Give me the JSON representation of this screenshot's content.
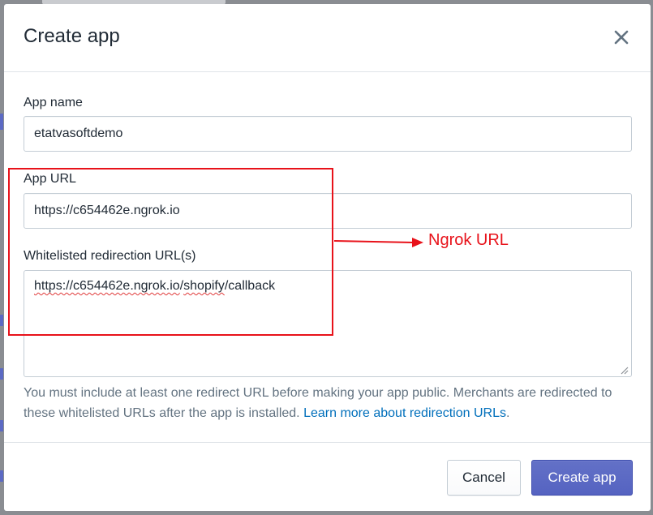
{
  "modal": {
    "title": "Create app",
    "close_icon": "close-icon"
  },
  "fields": {
    "app_name": {
      "label": "App name",
      "value": "etatvasoftdemo"
    },
    "app_url": {
      "label": "App URL",
      "value": "https://c654462e.ngrok.io"
    },
    "redirect_urls": {
      "label": "Whitelisted redirection URL(s)",
      "value_parts": [
        "https://c654462e.ngrok.io",
        "/",
        "shopify",
        "/callback"
      ]
    }
  },
  "help": {
    "text": "You must include at least one redirect URL before making your app public. Merchants are redirected to these whitelisted URLs after the app is installed. ",
    "link": "Learn more about redirection URLs",
    "suffix": "."
  },
  "buttons": {
    "cancel": "Cancel",
    "create": "Create app"
  },
  "annotation": {
    "label": "Ngrok URL",
    "color": "#e8121a"
  },
  "colors": {
    "primary": "#5c6ac4",
    "link": "#006fbb",
    "text": "#212b36",
    "muted": "#637381"
  }
}
